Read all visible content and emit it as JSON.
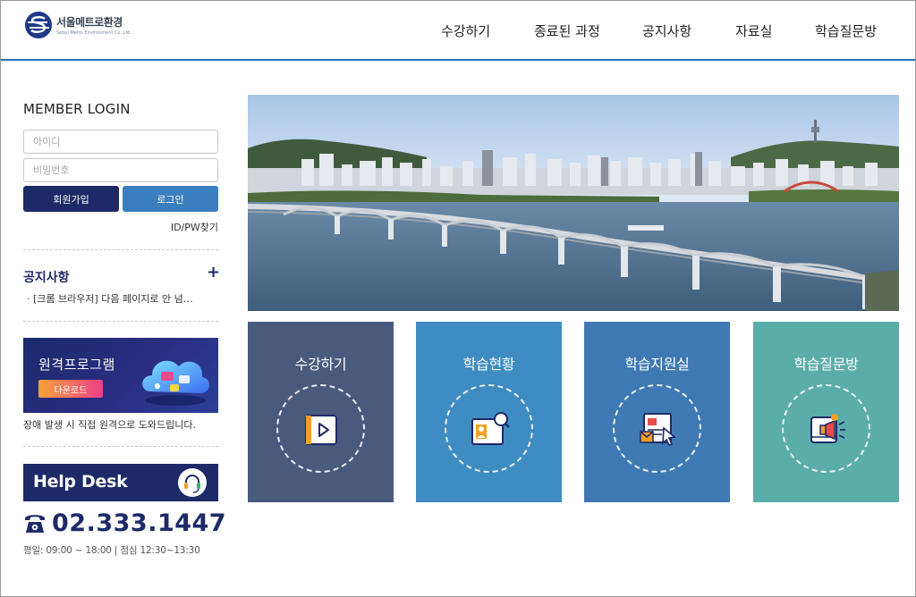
{
  "brand": {
    "name": "서울메트로환경",
    "sub": "Seoul Metro Environment Co.,Ltd."
  },
  "nav": [
    {
      "label": "수강하기"
    },
    {
      "label": "종료된 과정"
    },
    {
      "label": "공지사항"
    },
    {
      "label": "자료실"
    },
    {
      "label": "학습질문방"
    }
  ],
  "login": {
    "title": "MEMBER LOGIN",
    "id_placeholder": "아이디",
    "pw_placeholder": "비밀번호",
    "join_label": "회원가입",
    "login_label": "로그인",
    "find_label": "ID/PW찾기"
  },
  "notice": {
    "title": "공지사항",
    "more": "+",
    "items": [
      "· [크롬 브라우저] 다음 페이지로 안 넘…"
    ]
  },
  "remote": {
    "title": "원격프로그램",
    "download": "다운로드",
    "caption": "장애 발생 시 직접 원격으로 도와드립니다."
  },
  "helpdesk": {
    "title": "Help Desk",
    "phone": "02.333.1447",
    "hours": "평일: 09:00 ~ 18:00 | 점심 12:30~13:30"
  },
  "tiles": [
    {
      "label": "수강하기",
      "color": "#4a5a7d",
      "icon": "play-book-icon"
    },
    {
      "label": "학습현황",
      "color": "#3f8cc2",
      "icon": "profile-search-icon"
    },
    {
      "label": "학습지원실",
      "color": "#3f79b3",
      "icon": "support-docs-icon"
    },
    {
      "label": "학습질문방",
      "color": "#5bada9",
      "icon": "megaphone-icon"
    }
  ],
  "colors": {
    "navy": "#1d2a67",
    "blue": "#3b7fc0",
    "header_line": "#2f72b5"
  }
}
